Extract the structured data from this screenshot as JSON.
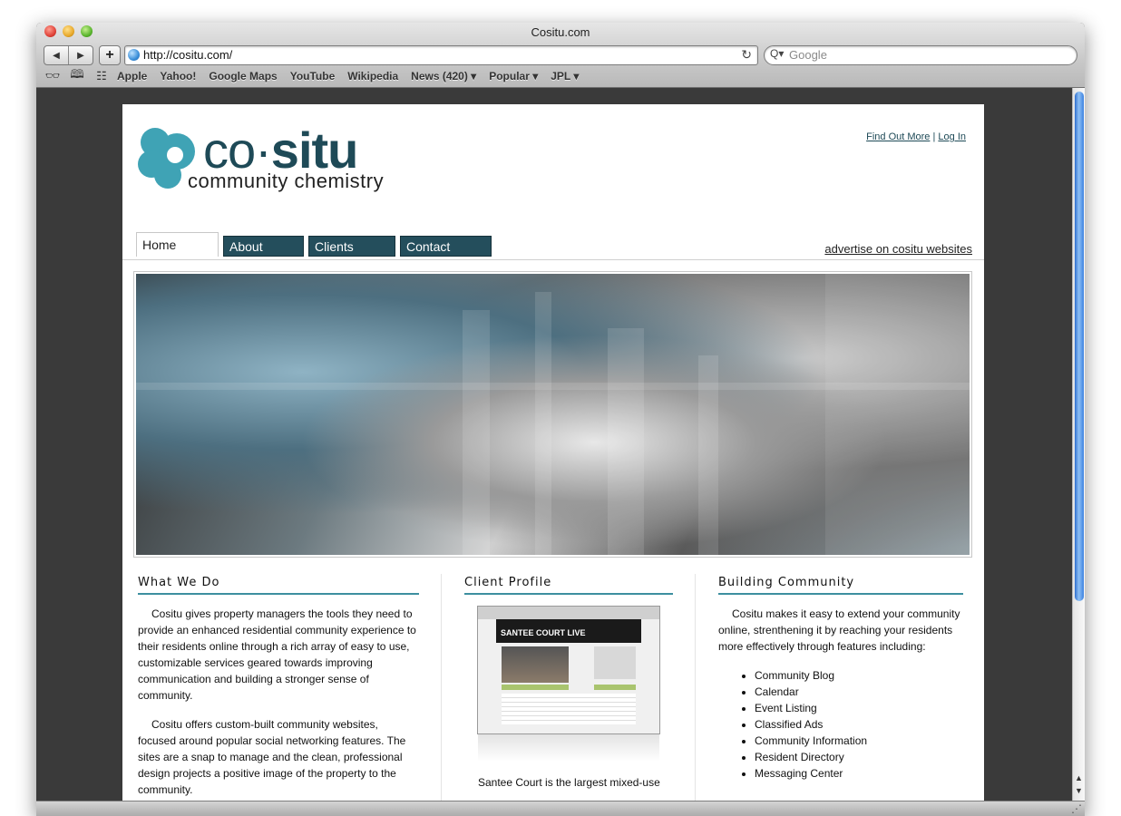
{
  "window": {
    "title": "Cositu.com"
  },
  "toolbar": {
    "back_label": "◀",
    "forward_label": "▶",
    "add_label": "+",
    "url": "http://cositu.com/",
    "reload_label": "↻",
    "search_placeholder": "Google",
    "search_icon": "Q▾"
  },
  "bookmarks": {
    "icons": [
      "reading-glasses-icon",
      "book-icon",
      "grid-icon"
    ],
    "items": [
      {
        "label": "Apple"
      },
      {
        "label": "Yahoo!"
      },
      {
        "label": "Google Maps"
      },
      {
        "label": "YouTube"
      },
      {
        "label": "Wikipedia"
      },
      {
        "label": "News (420) ▾"
      },
      {
        "label": "Popular ▾"
      },
      {
        "label": "JPL ▾"
      }
    ]
  },
  "site": {
    "logo": {
      "wordmark_co": "co·",
      "wordmark_situ": "situ",
      "tagline": "community chemistry"
    },
    "top_links": {
      "find_out_more": "Find Out More",
      "separator": "|",
      "log_in": "Log In"
    },
    "nav": {
      "tabs": [
        {
          "label": "Home",
          "active": true
        },
        {
          "label": "About",
          "active": false
        },
        {
          "label": "Clients",
          "active": false
        },
        {
          "label": "Contact",
          "active": false
        }
      ],
      "advertise": "advertise on cositu websites"
    },
    "what_we_do": {
      "heading": "What We Do",
      "para1": "Cositu gives property managers the tools they need to provide an enhanced residential community experience to their residents online through a rich array of easy to use, customizable services geared towards improving communication and building a stronger sense of community.",
      "para2": "Cositu offers custom-built community websites, focused around popular social networking features. The sites are a snap to manage and the clean, professional design projects a positive image of the property to the community."
    },
    "client_profile": {
      "heading": "Client Profile",
      "screenshot_title": "SANTEE COURT LIVE",
      "caption": "Santee Court is the largest mixed-use"
    },
    "building_community": {
      "heading": "Building Community",
      "intro": "Cositu makes it easy to extend your community online, strenthening it by reaching your residents more effectively through features including:",
      "features": [
        "Community Blog",
        "Calendar",
        "Event Listing",
        "Classified Ads",
        "Community Information",
        "Resident Directory",
        "Messaging Center"
      ]
    }
  },
  "colors": {
    "brand_teal": "#1e4a57",
    "accent": "#3d8f9f",
    "tab_bg": "#244e5c"
  }
}
